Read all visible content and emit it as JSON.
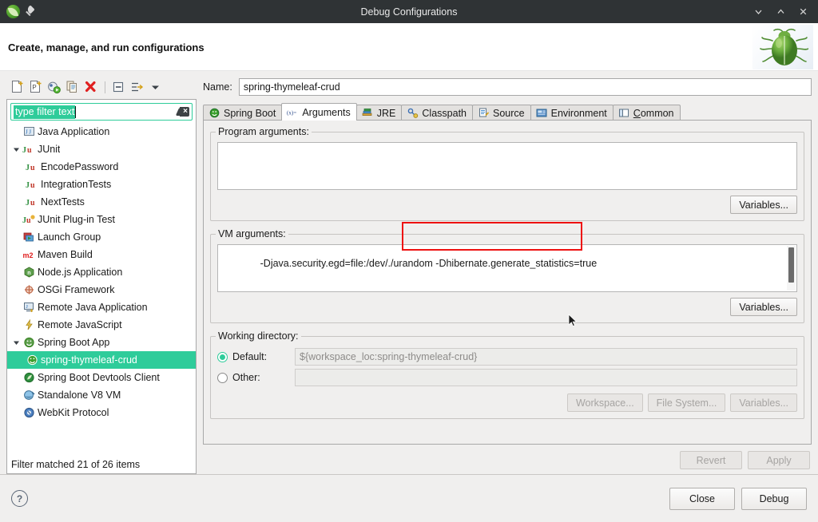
{
  "window": {
    "title": "Debug Configurations",
    "app_icon": "spring-leaf-icon",
    "pin_icon": "pin-icon",
    "minimize_label": "⌄",
    "maximize_label": "⌃",
    "close_label": "✕"
  },
  "banner": {
    "title": "Create, manage, and run configurations",
    "image": "green-bug-icon"
  },
  "toolbar": {
    "items": [
      {
        "name": "new-launch-configuration",
        "tooltip": "New launch configuration"
      },
      {
        "name": "new-prototype",
        "tooltip": "New prototype"
      },
      {
        "name": "link-prototype",
        "tooltip": "Link prototype"
      },
      {
        "name": "duplicate-configuration",
        "tooltip": "Duplicate"
      },
      {
        "name": "delete-configuration",
        "tooltip": "Delete"
      },
      {
        "name": "collapse-all",
        "tooltip": "Collapse All"
      },
      {
        "name": "filter-configurations",
        "tooltip": "Filter launch configurations"
      },
      {
        "name": "view-menu-dropdown",
        "tooltip": "View Menu"
      }
    ]
  },
  "filter": {
    "text": "type filter text",
    "placeholder": "type filter text",
    "selected": true,
    "clear_icon": "clear-filter-icon"
  },
  "tree": {
    "items": [
      {
        "label": "Java Application",
        "icon": "java-application-icon",
        "level": 1,
        "expandable": false,
        "selected": false
      },
      {
        "label": "JUnit",
        "icon": "junit-icon",
        "level": 1,
        "expandable": true,
        "expanded": true,
        "selected": false
      },
      {
        "label": "EncodePassword",
        "icon": "junit-test-icon",
        "level": 2,
        "expandable": false,
        "selected": false
      },
      {
        "label": "IntegrationTests",
        "icon": "junit-test-icon",
        "level": 2,
        "expandable": false,
        "selected": false
      },
      {
        "label": "NextTests",
        "icon": "junit-test-icon",
        "level": 2,
        "expandable": false,
        "selected": false
      },
      {
        "label": "JUnit Plug-in Test",
        "icon": "junit-plugin-test-icon",
        "level": 1,
        "expandable": false,
        "selected": false
      },
      {
        "label": "Launch Group",
        "icon": "launch-group-icon",
        "level": 1,
        "expandable": false,
        "selected": false
      },
      {
        "label": "Maven Build",
        "icon": "maven-icon",
        "level": 1,
        "expandable": false,
        "selected": false
      },
      {
        "label": "Node.js Application",
        "icon": "nodejs-icon",
        "level": 1,
        "expandable": false,
        "selected": false
      },
      {
        "label": "OSGi Framework",
        "icon": "osgi-icon",
        "level": 1,
        "expandable": false,
        "selected": false
      },
      {
        "label": "Remote Java Application",
        "icon": "remote-java-icon",
        "level": 1,
        "expandable": false,
        "selected": false
      },
      {
        "label": "Remote JavaScript",
        "icon": "remote-javascript-icon",
        "level": 1,
        "expandable": false,
        "selected": false
      },
      {
        "label": "Spring Boot App",
        "icon": "spring-boot-icon",
        "level": 1,
        "expandable": true,
        "expanded": true,
        "selected": false
      },
      {
        "label": "spring-thymeleaf-crud",
        "icon": "spring-boot-icon",
        "level": 2,
        "expandable": false,
        "selected": true
      },
      {
        "label": "Spring Boot Devtools Client",
        "icon": "spring-devtools-icon",
        "level": 1,
        "expandable": false,
        "selected": false
      },
      {
        "label": "Standalone V8 VM",
        "icon": "v8-vm-icon",
        "level": 1,
        "expandable": false,
        "selected": false
      },
      {
        "label": "WebKit Protocol",
        "icon": "webkit-icon",
        "level": 1,
        "expandable": false,
        "selected": false
      }
    ],
    "status": "Filter matched 21 of 26 items"
  },
  "config": {
    "name_label": "Name:",
    "name_value": "spring-thymeleaf-crud",
    "tabs": [
      {
        "label": "Spring Boot",
        "icon": "spring-boot-icon",
        "active": false
      },
      {
        "label": "Arguments",
        "icon": "arguments-icon",
        "active": true
      },
      {
        "label": "JRE",
        "icon": "jre-icon",
        "active": false
      },
      {
        "label": "Classpath",
        "icon": "classpath-icon",
        "active": false
      },
      {
        "label": "Source",
        "icon": "source-icon",
        "active": false
      },
      {
        "label": "Environment",
        "icon": "environment-icon",
        "active": false
      },
      {
        "label": "Common",
        "icon": "common-icon",
        "active": false,
        "mnemonic": "C"
      }
    ]
  },
  "arguments_tab": {
    "program_arguments": {
      "group_label": "Program arguments:",
      "value": "",
      "variables_button": "Variables..."
    },
    "vm_arguments": {
      "group_label": "VM arguments:",
      "value": "-Djava.security.egd=file:/dev/./urandom -Dhibernate.generate_statistics=true",
      "highlighted_part": "-Dhibernate.generate_statistics=true",
      "highlight_color": "#ee1111",
      "variables_button": "Variables...",
      "has_scrollbar": true
    },
    "working_directory": {
      "group_label": "Working directory:",
      "default_label": "Default:",
      "default_value": "${workspace_loc:spring-thymeleaf-crud}",
      "default_selected": true,
      "other_label": "Other:",
      "other_value": "",
      "other_selected": false,
      "workspace_button": "Workspace...",
      "file_system_button": "File System...",
      "variables_button": "Variables..."
    }
  },
  "actions": {
    "revert": "Revert",
    "revert_disabled": true,
    "apply": "Apply",
    "apply_disabled": true,
    "help_icon": "help-icon",
    "close": "Close",
    "debug": "Debug"
  },
  "colors": {
    "selection": "#2ecc9a",
    "titlebar": "#2f3335",
    "dialog_bg": "#f0efee",
    "highlight": "#ee1111"
  }
}
